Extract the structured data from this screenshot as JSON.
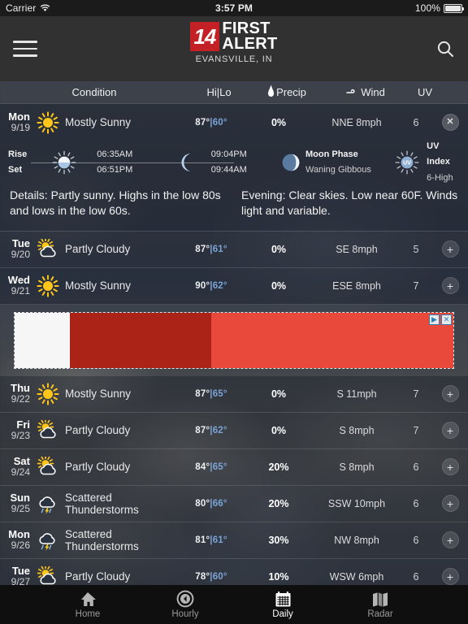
{
  "status_bar": {
    "carrier": "Carrier",
    "wifi_icon": "wifi-icon",
    "time": "3:57 PM",
    "battery_pct": "100%",
    "battery_icon": "battery-full-icon"
  },
  "nav": {
    "menu_icon": "hamburger-menu-icon",
    "search_icon": "search-icon",
    "logo_number": "14",
    "logo_line1": "FIRST",
    "logo_line2": "ALERT",
    "location": "EVANSVILLE, IN",
    "brand_red": "#c42127"
  },
  "columns": {
    "condition": "Condition",
    "hilo": "Hi|Lo",
    "precip": "Precip",
    "precip_icon": "water-droplet-icon",
    "wind": "Wind",
    "wind_icon": "wind-swirl-icon",
    "uv": "UV"
  },
  "forecast": [
    {
      "day": "Mon",
      "date": "9/19",
      "icon": "sun-icon",
      "condition": "Mostly Sunny",
      "hi": "87°",
      "lo": "60°",
      "precip": "0%",
      "wind": "NNE 8mph",
      "uv": "6",
      "action_icon": "close-icon",
      "expanded": true
    },
    {
      "day": "Tue",
      "date": "9/20",
      "icon": "sun-cloud-icon",
      "condition": "Partly Cloudy",
      "hi": "87°",
      "lo": "61°",
      "precip": "0%",
      "wind": "SE 8mph",
      "uv": "5",
      "action_icon": "plus-icon",
      "expanded": false
    },
    {
      "day": "Wed",
      "date": "9/21",
      "icon": "sun-icon",
      "condition": "Mostly Sunny",
      "hi": "90°",
      "lo": "62°",
      "precip": "0%",
      "wind": "ESE 8mph",
      "uv": "7",
      "action_icon": "plus-icon",
      "expanded": false
    },
    {
      "day": "Thu",
      "date": "9/22",
      "icon": "sun-icon",
      "condition": "Mostly Sunny",
      "hi": "87°",
      "lo": "65°",
      "precip": "0%",
      "wind": "S 11mph",
      "uv": "7",
      "action_icon": "plus-icon",
      "expanded": false
    },
    {
      "day": "Fri",
      "date": "9/23",
      "icon": "sun-cloud-icon",
      "condition": "Partly Cloudy",
      "hi": "87°",
      "lo": "62°",
      "precip": "0%",
      "wind": "S 8mph",
      "uv": "7",
      "action_icon": "plus-icon",
      "expanded": false
    },
    {
      "day": "Sat",
      "date": "9/24",
      "icon": "sun-cloud-icon",
      "condition": "Partly Cloudy",
      "hi": "84°",
      "lo": "65°",
      "precip": "20%",
      "wind": "S 8mph",
      "uv": "6",
      "action_icon": "plus-icon",
      "expanded": false
    },
    {
      "day": "Sun",
      "date": "9/25",
      "icon": "thunderstorm-icon",
      "condition": "Scattered Thunderstorms",
      "hi": "80°",
      "lo": "66°",
      "precip": "20%",
      "wind": "SSW 10mph",
      "uv": "6",
      "action_icon": "plus-icon",
      "expanded": false
    },
    {
      "day": "Mon",
      "date": "9/26",
      "icon": "thunderstorm-icon",
      "condition": "Scattered Thunderstorms",
      "hi": "81°",
      "lo": "61°",
      "precip": "30%",
      "wind": "NW 8mph",
      "uv": "6",
      "action_icon": "plus-icon",
      "expanded": false
    },
    {
      "day": "Tue",
      "date": "9/27",
      "icon": "sun-cloud-icon",
      "condition": "Partly Cloudy",
      "hi": "78°",
      "lo": "60°",
      "precip": "10%",
      "wind": "WSW 6mph",
      "uv": "6",
      "action_icon": "plus-icon",
      "expanded": false
    }
  ],
  "detail": {
    "rise_label": "Rise",
    "set_label": "Set",
    "sun_icon": "sunrise-sunset-icon",
    "sun_rise": "06:35AM",
    "sun_set": "06:51PM",
    "moon_icon": "crescent-moon-icon",
    "moon_rise": "09:04PM",
    "moon_set": "09:44AM",
    "phase_icon": "moon-phase-icon",
    "phase_label": "Moon Phase",
    "phase_value": "Waning Gibbous",
    "uv_icon": "uv-index-icon",
    "uv_label": "UV Index",
    "uv_value": "6-High",
    "details_text": "Details: Partly sunny. Highs in the low 80s and lows in the low 60s.",
    "evening_text": "Evening: Clear skies. Low near 60F. Winds light and variable."
  },
  "ad": {
    "adchoices_icon": "adchoices-triangle-icon",
    "close_icon": "ad-close-icon",
    "adchoices_glyph": "▶",
    "close_glyph": "✕",
    "color_panel_white": "#f6f6f6",
    "color_panel_dark_red": "#ab2316",
    "color_panel_red": "#e8493a"
  },
  "tabs": [
    {
      "label": "Home",
      "icon": "home-icon",
      "active": false
    },
    {
      "label": "Hourly",
      "icon": "clock-icon",
      "active": false
    },
    {
      "label": "Daily",
      "icon": "calendar-icon",
      "active": true
    },
    {
      "label": "Radar",
      "icon": "map-icon",
      "active": false
    }
  ]
}
